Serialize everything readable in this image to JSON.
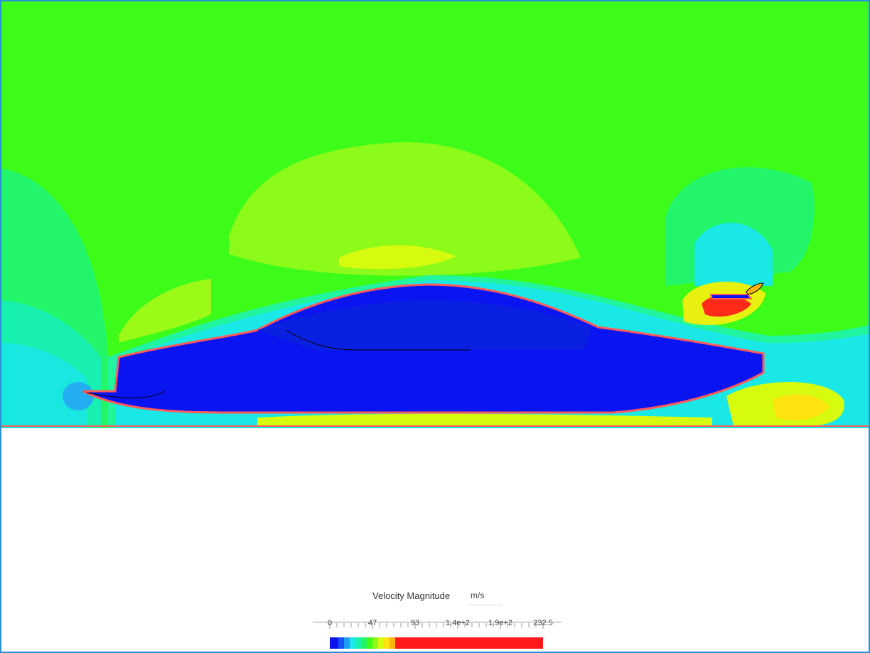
{
  "legend": {
    "title": "Velocity Magnitude",
    "unit": "m/s",
    "labels": [
      "0",
      "47",
      "93",
      "1.4e+2",
      "1.9e+2",
      "232.5"
    ]
  },
  "colors": {
    "far_field": "#3dfc1a",
    "body_interior": "#0a14f0",
    "surface_outline": "#ff5a5a",
    "frame_border": "#2a8fd6"
  }
}
